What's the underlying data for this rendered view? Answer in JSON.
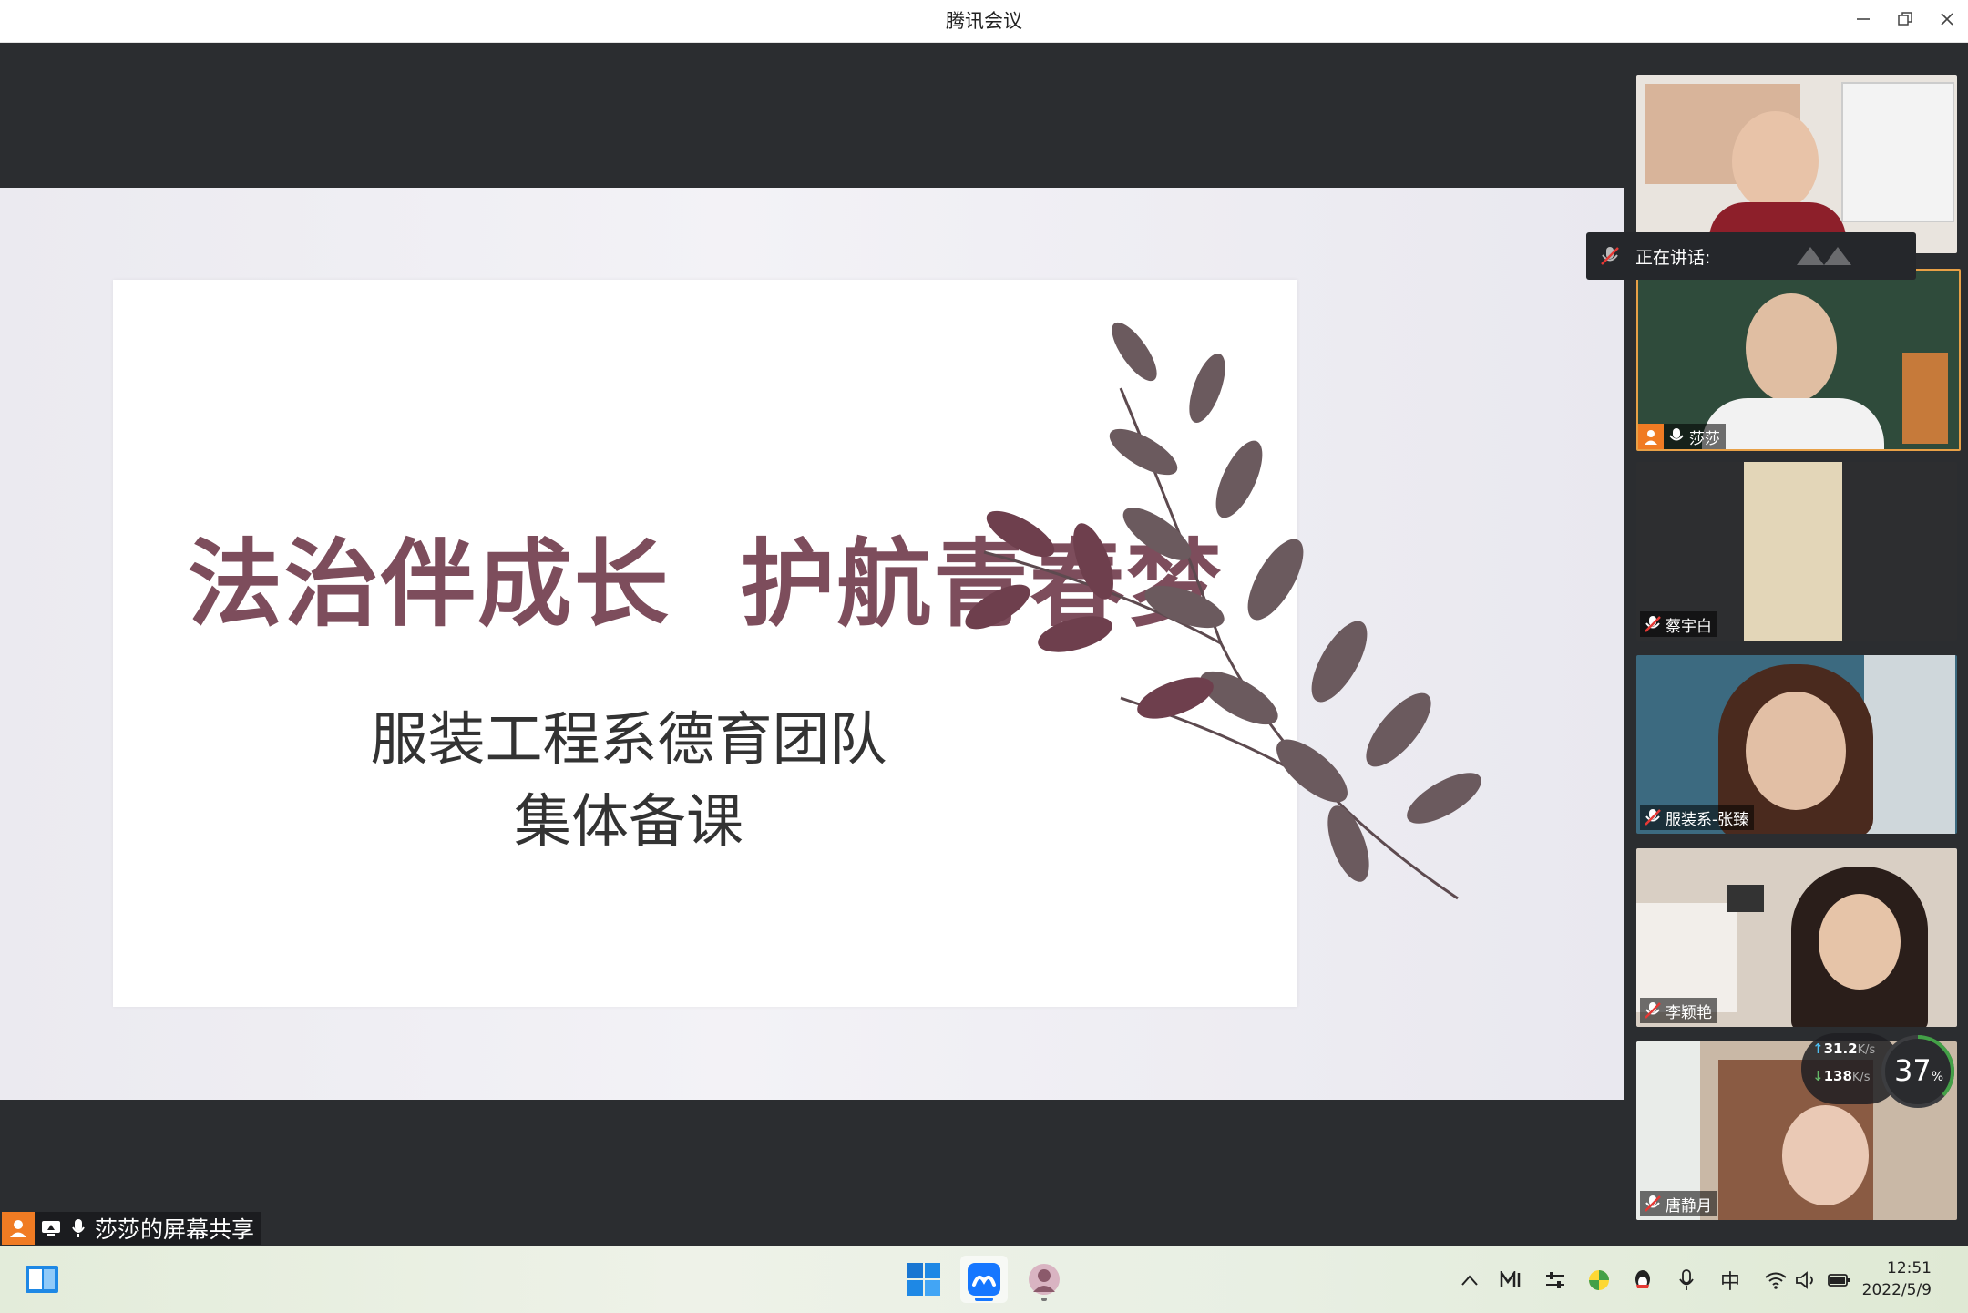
{
  "window": {
    "title": "腾讯会议"
  },
  "slide": {
    "title": "法治伴成长  护航青春梦",
    "subtitle_line1": "服装工程系德育团队",
    "subtitle_line2": "集体备课"
  },
  "share": {
    "label": "莎莎的屏幕共享"
  },
  "speaking": {
    "label": "正在讲话:"
  },
  "participants": [
    {
      "name": "",
      "muted": true
    },
    {
      "name": "莎莎",
      "muted": false,
      "host": true
    },
    {
      "name": "蔡宇白",
      "muted": true
    },
    {
      "name": "服装系-张臻",
      "muted": true
    },
    {
      "name": "李颖艳",
      "muted": true
    },
    {
      "name": "唐静月",
      "muted": true
    }
  ],
  "network": {
    "up": "31.2",
    "up_unit": "K/s",
    "down": "138",
    "down_unit": "K/s",
    "percent": "37",
    "percent_sign": "%"
  },
  "tray": {
    "ime": "中"
  },
  "clock": {
    "time": "12:51",
    "date": "2022/5/9"
  },
  "colors": {
    "accent": "#f07b23",
    "slide_title": "#7d4d5c",
    "sidebar_bg": "#2b2d30"
  }
}
